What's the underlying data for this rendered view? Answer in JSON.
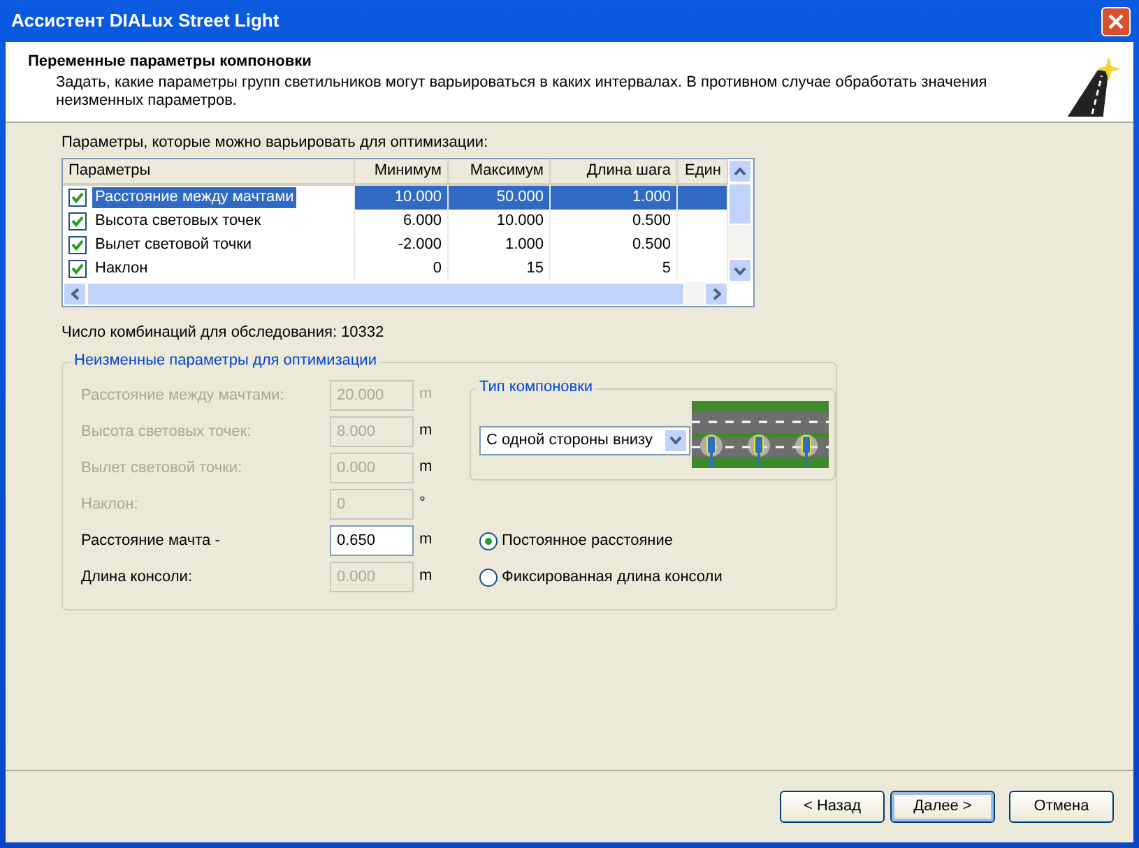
{
  "window": {
    "title": "Ассистент DIALux Street Light"
  },
  "header": {
    "title": "Переменные параметры компоновки",
    "description": "Задать, какие параметры групп светильников могут варьироваться в каких интервалах. В противном случае обработать значения неизменных параметров."
  },
  "params_label": "Параметры, которые можно варьировать для оптимизации:",
  "table": {
    "columns": [
      "Параметры",
      "Минимум",
      "Максимум",
      "Длина шага",
      "Един"
    ],
    "rows": [
      {
        "checked": true,
        "selected": true,
        "cells": [
          "Расстояние между мачтами",
          "10.000",
          "50.000",
          "1.000"
        ]
      },
      {
        "checked": true,
        "selected": false,
        "cells": [
          "Высота световых точек",
          "6.000",
          "10.000",
          "0.500"
        ]
      },
      {
        "checked": true,
        "selected": false,
        "cells": [
          "Вылет световой точки",
          "-2.000",
          "1.000",
          "0.500"
        ]
      },
      {
        "checked": true,
        "selected": false,
        "cells": [
          "Наклон",
          "0",
          "15",
          "5"
        ]
      }
    ]
  },
  "combinations": "Число комбинаций для обследования: 10332",
  "fixed_group": {
    "title": "Неизменные параметры для оптимизации",
    "fields": [
      {
        "label": "Расстояние между мачтами:",
        "label_disabled": true,
        "value": "20.000",
        "disabled": true,
        "unit": "m",
        "unit_disabled": true
      },
      {
        "label": "Высота световых точек:",
        "label_disabled": true,
        "value": "8.000",
        "disabled": true,
        "unit": "m",
        "unit_disabled": false
      },
      {
        "label": "Вылет световой точки:",
        "label_disabled": true,
        "value": "0.000",
        "disabled": true,
        "unit": "m",
        "unit_disabled": false
      },
      {
        "label": "Наклон:",
        "label_disabled": true,
        "value": "0",
        "disabled": true,
        "unit": "°",
        "unit_disabled": false
      },
      {
        "label": "Расстояние мачта -",
        "label_disabled": false,
        "value": "0.650",
        "disabled": false,
        "unit": "m",
        "unit_disabled": false
      },
      {
        "label": "Длина консоли:",
        "label_disabled": false,
        "value": "0.000",
        "disabled": true,
        "unit": "m",
        "unit_disabled": false
      }
    ],
    "layout_type": {
      "title": "Тип компоновки",
      "value": "С одной стороны внизу"
    },
    "radios": [
      {
        "label": "Постоянное расстояние",
        "selected": true
      },
      {
        "label": "Фиксированная длина консоли",
        "selected": false
      }
    ]
  },
  "buttons": [
    {
      "label": "< Назад",
      "default": false
    },
    {
      "label": "Далее >",
      "default": true
    },
    {
      "label": "Отмена",
      "default": false
    }
  ]
}
